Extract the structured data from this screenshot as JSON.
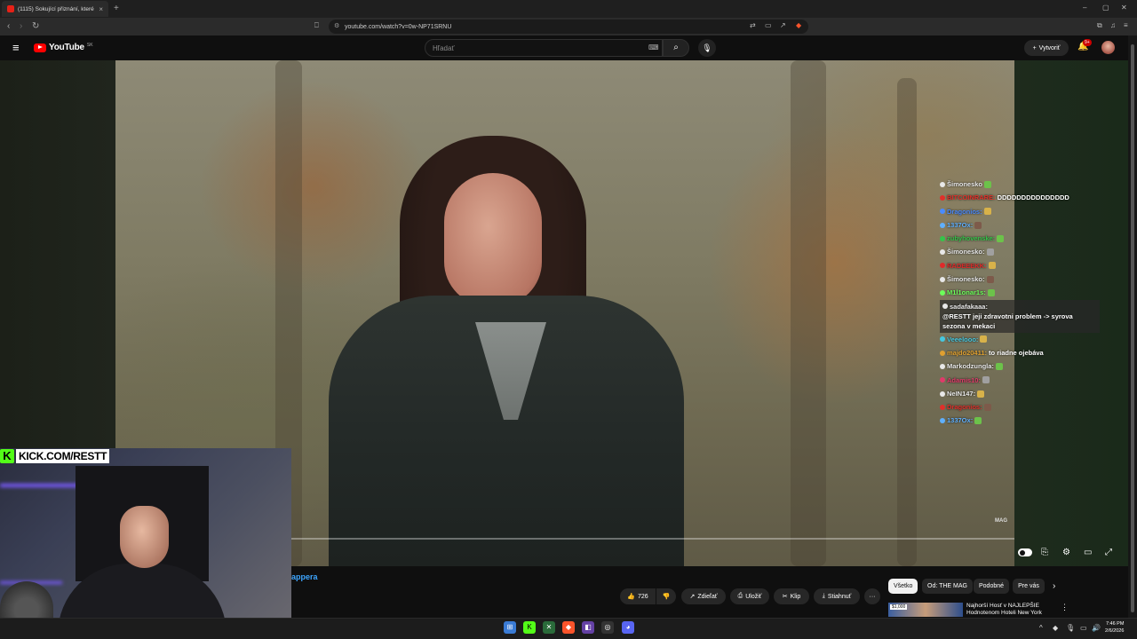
{
  "browser": {
    "tab_title": "(1115) Šokující přiznání, které zm",
    "tab_close": "×",
    "new_tab": "+",
    "url": "youtube.com/watch?v=0w-NP71SRNU",
    "win_min": "–",
    "win_max": "▢",
    "win_close": "✕"
  },
  "youtube": {
    "logo_text": "YouTube",
    "country_code": "SK",
    "search_placeholder": "Hľadať",
    "create_label": "Vytvoriť",
    "notif_badge": "9+",
    "icons": [
      "menu-icon",
      "search-icon",
      "mic-icon",
      "bell-icon",
      "keyboard-icon"
    ]
  },
  "chat": [
    {
      "user": "Šimonesko",
      "color": "#e8e8e8",
      "msg": ""
    },
    {
      "user": "BITCOINRARE:",
      "color": "#e0302a",
      "msg": "DDDDDDDDDDDDDDD"
    },
    {
      "user": "Dragonios:",
      "color": "#4a8bff",
      "msg": ""
    },
    {
      "user": "1337Ox:",
      "color": "#5fb0ff",
      "msg": ""
    },
    {
      "user": "zubyhovenske:",
      "color": "#35c44a",
      "msg": ""
    },
    {
      "user": "Šimonesko:",
      "color": "#e8e8e8",
      "msg": ""
    },
    {
      "user": "RADEEEKK:",
      "color": "#e02a2a",
      "msg": ""
    },
    {
      "user": "Šimonesko:",
      "color": "#e8e8e8",
      "msg": ""
    },
    {
      "user": "M1l1onar1s:",
      "color": "#6cff5a",
      "msg": ""
    },
    {
      "user": "sadafakaaa:",
      "color": "#e8e8e8",
      "msg": "@RESTT jeji zdravotni problem -> syrova sezona v mekaci",
      "highlight": true
    },
    {
      "user": "Veeelooo:",
      "color": "#46c8e0",
      "msg": ""
    },
    {
      "user": "majdo20411:",
      "color": "#e0a030",
      "msg": "to riadne ojebáva"
    },
    {
      "user": "Markodzungla:",
      "color": "#e8e8e8",
      "msg": ""
    },
    {
      "user": "Adamis10:",
      "color": "#e03a6a",
      "msg": ""
    },
    {
      "user": "NeIN147:",
      "color": "#e8e8e8",
      "msg": ""
    },
    {
      "user": "Dragonios:",
      "color": "#e0302a",
      "msg": ""
    },
    {
      "user": "1337Ox:",
      "color": "#5fb0ff",
      "msg": ""
    }
  ],
  "video": {
    "watermark": "MAG",
    "kick_badge": "K",
    "kick_text": "KICK.COM/RESTT",
    "channel_partial": "appera"
  },
  "actions": {
    "likes": "726",
    "share": "Zdieľať",
    "save": "Uložiť",
    "clip": "Klip",
    "download": "Stiahnuť",
    "more": "···"
  },
  "chips": [
    "Všetko",
    "Od: THE MAG",
    "Podobné",
    "Pre vás"
  ],
  "recommendation": {
    "badge": "$1,000",
    "title": "Najhorší Hosť v NAJLEPŠIE Hodnotenom Hoteli New York"
  },
  "taskbar": {
    "time": "7:46 PM",
    "date": "2/6/2026"
  },
  "colors": {
    "accent": "#ff0000",
    "kick": "#53fc18",
    "link": "#3ea6ff"
  }
}
